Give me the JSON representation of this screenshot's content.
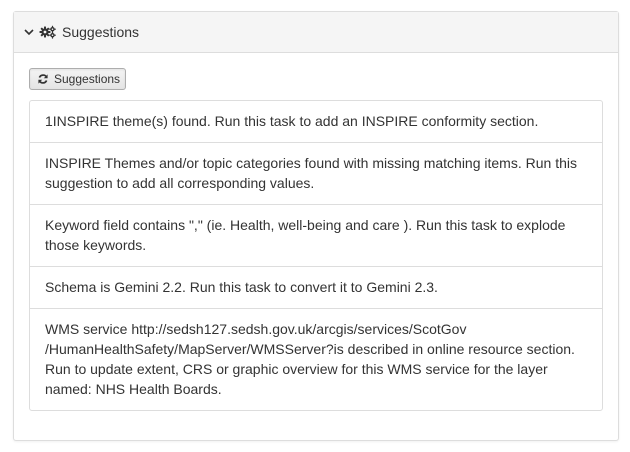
{
  "panel": {
    "title": "Suggestions"
  },
  "toolbar": {
    "suggestions_button_label": "Suggestions"
  },
  "suggestions": [
    "1INSPIRE theme(s) found. Run this task to add an INSPIRE conformity section.",
    "INSPIRE Themes and/or topic categories found with missing matching items. Run this suggestion to add all corresponding values.",
    "Keyword field contains \",\" (ie. Health, well-being and care ). Run this task to explode those keywords.",
    "Schema is Gemini 2.2. Run this task to convert it to Gemini 2.3.",
    "WMS service http://sedsh127.sedsh.gov.uk/arcgis/services/ScotGov /HumanHealthSafety/MapServer/WMSServer?is described in online resource section. Run to update extent, CRS or graphic overview for this WMS service for the layer named: NHS Health Boards."
  ],
  "icons": {
    "collapse": "chevron-down-icon",
    "header": "gears-icon",
    "button": "refresh-icon"
  }
}
